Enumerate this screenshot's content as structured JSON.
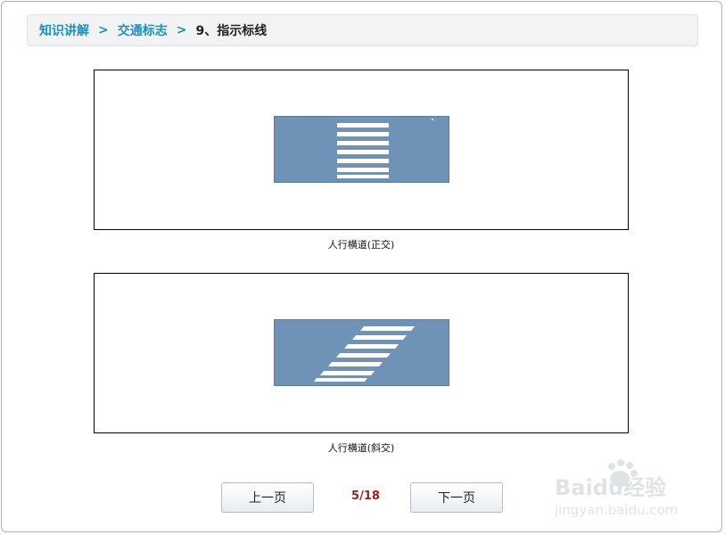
{
  "breadcrumb": {
    "items": [
      "知识讲解",
      "交通标志"
    ],
    "separator": ">",
    "current": "9、指示标线"
  },
  "figures": [
    {
      "caption": "人行横道(正交)",
      "type": "perpendicular"
    },
    {
      "caption": "人行横道(斜交)",
      "type": "diagonal"
    }
  ],
  "pagination": {
    "prev_label": "上一页",
    "page_indicator": "5/18",
    "next_label": "下一页"
  },
  "watermark": {
    "logo": "Baidu经验",
    "url": "jingyan.baidu.com"
  },
  "colors": {
    "link": "#1d8fc0",
    "road": "#6e93b6",
    "page_indicator": "#9e1c1c"
  }
}
